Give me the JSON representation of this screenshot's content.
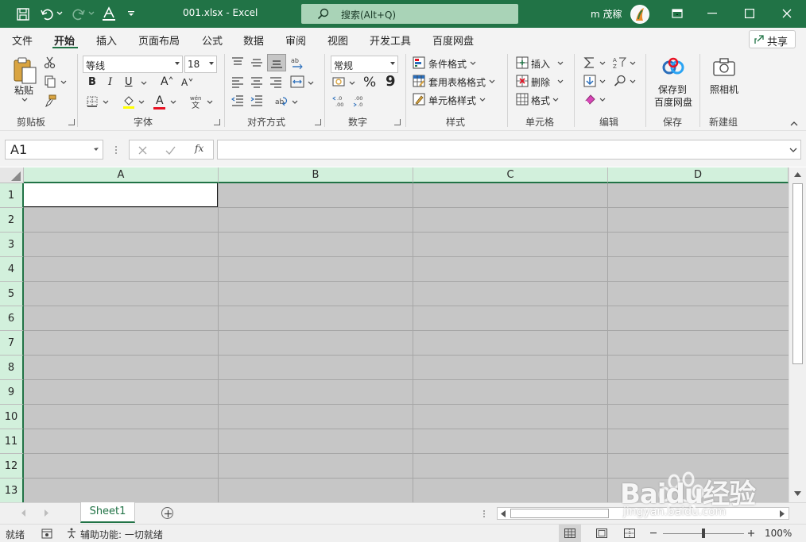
{
  "titlebar": {
    "filename": "001.xlsx",
    "separator": "-",
    "app": "Excel",
    "search_placeholder": "搜索(Alt+Q)",
    "user": "m 茂稼"
  },
  "tabs": [
    "文件",
    "开始",
    "插入",
    "页面布局",
    "公式",
    "数据",
    "审阅",
    "视图",
    "开发工具",
    "百度网盘"
  ],
  "share_label": "共享",
  "ribbon": {
    "clipboard": {
      "paste": "粘贴",
      "group": "剪贴板"
    },
    "font": {
      "name": "等线",
      "size": "18",
      "bold": "B",
      "italic": "I",
      "underline": "U",
      "grow": "A",
      "shrink": "A",
      "color_a": "A",
      "group": "字体"
    },
    "alignment": {
      "group": "对齐方式"
    },
    "number": {
      "format": "常规",
      "percent": "%",
      "comma": "9",
      "group": "数字"
    },
    "styles": {
      "conditional": "条件格式",
      "table": "套用表格格式",
      "cell": "单元格样式",
      "group": "样式"
    },
    "cells": {
      "insert": "插入",
      "delete": "删除",
      "format": "格式",
      "group": "单元格"
    },
    "editing": {
      "group": "编辑"
    },
    "save": {
      "line1": "保存到",
      "line2": "百度网盘",
      "group": "保存"
    },
    "camera": {
      "label": "照相机",
      "group": "新建组"
    }
  },
  "formula_bar": {
    "cell_ref": "A1",
    "fx": "fx",
    "value": ""
  },
  "columns": [
    "A",
    "B",
    "C",
    "D"
  ],
  "rows": [
    "1",
    "2",
    "3",
    "4",
    "5",
    "6",
    "7",
    "8",
    "9",
    "10",
    "11",
    "12",
    "13"
  ],
  "sheets": [
    "Sheet1"
  ],
  "status": {
    "ready": "就绪",
    "accessibility": "辅助功能: 一切就绪",
    "zoom": "100%"
  },
  "watermark": {
    "brand": "Baidu经验",
    "url": "jingyan.baidu.com"
  },
  "colors": {
    "accent": "#217346",
    "header_highlight": "#d2f0dc",
    "grey_cells": "#c6c6c6"
  }
}
